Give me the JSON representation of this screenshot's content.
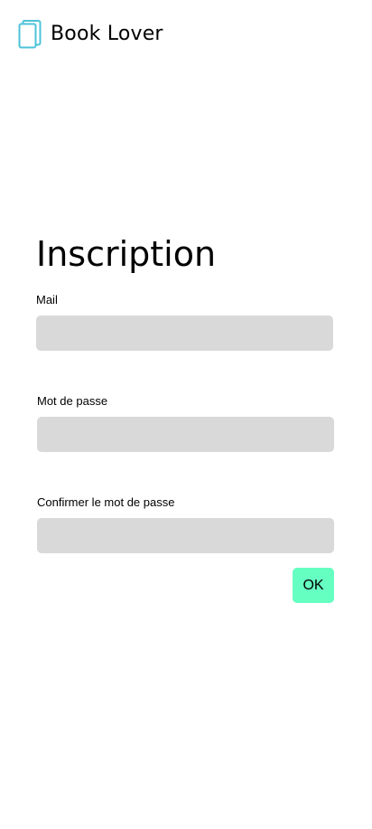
{
  "header": {
    "app_title": "Book Lover",
    "logo_icon": "book-icon",
    "logo_color": "#4cc3d9"
  },
  "form": {
    "title": "Inscription",
    "fields": [
      {
        "label": "Mail",
        "value": "",
        "placeholder": ""
      },
      {
        "label": "Mot de passe",
        "value": "",
        "placeholder": ""
      },
      {
        "label": "Confirmer le mot de passe",
        "value": "",
        "placeholder": ""
      }
    ],
    "submit_label": "OK",
    "submit_color": "#66ffc2",
    "input_background": "#d9d9d9"
  }
}
